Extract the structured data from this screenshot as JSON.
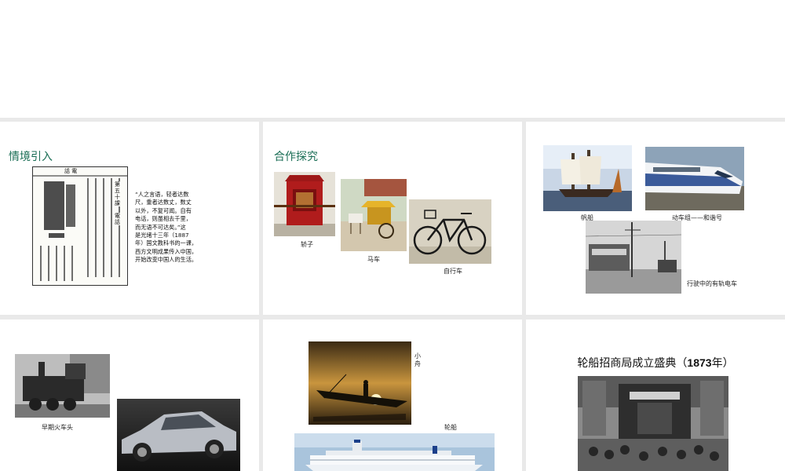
{
  "slide1": {
    "heading": "情境引入",
    "passage": [
      "“人之言语，轻者达数",
      "尺，重者达数丈，数丈",
      "以外，不复可闻。自有",
      "电话，则虽相去千里，",
      "而无语不可达矣。”这",
      "是光绪十三年（1887",
      "年）国文教科书的一课，",
      "西方文明成果传入中国，",
      "开始改变中国人的生活。"
    ],
    "textbook": {
      "header": "話 電",
      "lesson_title": "第五十課",
      "lesson_name": "電話"
    }
  },
  "slide2": {
    "heading": "合作探究",
    "captions": {
      "sedan": "轿子",
      "carriage": "马车",
      "bicycle": "自行车"
    }
  },
  "slide3": {
    "captions": {
      "sailboat": "帆船",
      "train": "动车组——和谐号",
      "tram": "行驶中的有轨电车"
    }
  },
  "slide4": {
    "captions": {
      "locomotive": "早期火车头"
    }
  },
  "slide5": {
    "captions": {
      "boat": "小舟",
      "ship": "轮船"
    }
  },
  "slide6": {
    "title_prefix": "轮船招商局成立盛典（",
    "title_year": "1873",
    "title_suffix": "年）"
  }
}
